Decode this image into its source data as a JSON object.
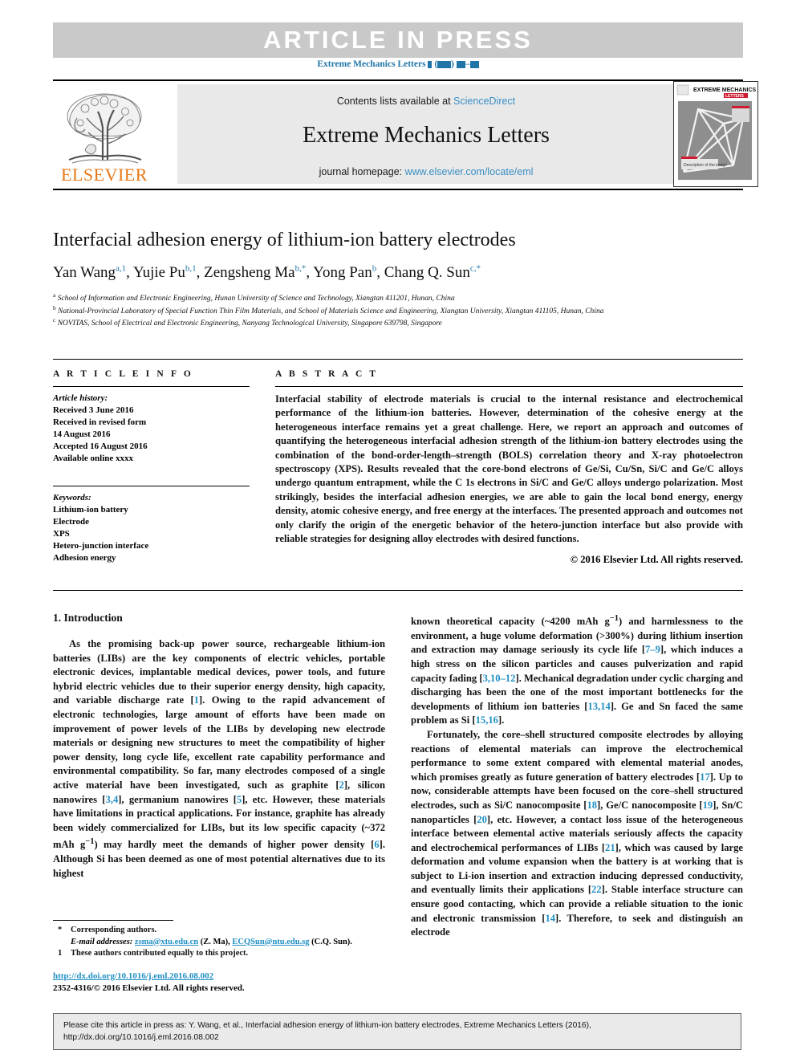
{
  "header": {
    "article_in_press": "ARTICLE  IN  PRESS",
    "running_journal": "Extreme Mechanics Letters",
    "running_suffix_open": "(",
    "running_suffix_close": ")",
    "running_dash": "–"
  },
  "masthead": {
    "contents_prefix": "Contents lists available at ",
    "contents_link": "ScienceDirect",
    "journal_title": "Extreme Mechanics Letters",
    "homepage_prefix": "journal homepage: ",
    "homepage_link": "www.elsevier.com/locate/eml",
    "publisher": "ELSEVIER",
    "cover_title_line1": "EXTREME MECHANICS",
    "cover_title_line2": "LETTERS",
    "cover_caption": "Description of the image",
    "accent_blue": "#1f74a8",
    "link_blue": "#3b8fc4",
    "elsevier_orange": "#e77817"
  },
  "article": {
    "title": "Interfacial adhesion energy of lithium-ion battery electrodes",
    "authors": [
      {
        "name": "Yan Wang",
        "sup": "a,1",
        "sep": ", "
      },
      {
        "name": "Yujie Pu",
        "sup": "b,1",
        "sep": ", "
      },
      {
        "name": "Zengsheng Ma",
        "sup": "b,*",
        "sep": ", "
      },
      {
        "name": "Yong Pan",
        "sup": "b",
        "sep": ", "
      },
      {
        "name": "Chang Q. Sun",
        "sup": "c,*",
        "sep": ""
      }
    ],
    "affiliations": [
      {
        "mark": "a",
        "text": "School of Information and Electronic Engineering, Hunan University of Science and Technology, Xiangtan 411201, Hunan, China"
      },
      {
        "mark": "b",
        "text": "National-Provincial Laboratory of Special Function Thin Film Materials, and School of Materials Science and Engineering, Xiangtan University, Xiangtan 411105, Hunan, China"
      },
      {
        "mark": "c",
        "text": "NOVITAS, School of Electrical and Electronic Engineering, Nanyang Technological University, Singapore 639798, Singapore"
      }
    ]
  },
  "info": {
    "heading": "A R T I C L E    I N F O",
    "history_label": "Article history:",
    "history": [
      "Received 3 June 2016",
      "Received in revised form",
      "14 August 2016",
      "Accepted 16 August 2016",
      "Available online xxxx"
    ],
    "keywords_label": "Keywords:",
    "keywords": [
      "Lithium-ion battery",
      "Electrode",
      "XPS",
      "Hetero-junction interface",
      "Adhesion energy"
    ]
  },
  "abstract": {
    "heading": "A B S T R A C T",
    "body": "Interfacial stability of electrode materials is crucial to the internal resistance and electrochemical performance of the lithium-ion batteries. However, determination of the cohesive energy at the heterogeneous interface remains yet a great challenge. Here, we report an approach and outcomes of quantifying the heterogeneous interfacial adhesion strength of the lithium-ion battery electrodes using the combination of the bond-order-length–strength (BOLS) correlation theory and X-ray photoelectron spectroscopy (XPS). Results revealed that the core-bond electrons of Ge/Si, Cu/Sn, Si/C and Ge/C alloys undergo quantum entrapment, while the C 1s electrons in Si/C and Ge/C alloys undergo polarization. Most strikingly, besides the interfacial adhesion energies, we are able to gain the local bond energy, energy density, atomic cohesive energy, and free energy at the interfaces. The presented approach and outcomes not only clarify the origin of the energetic behavior of the hetero-junction interface but also provide with reliable strategies for designing alloy electrodes with desired functions.",
    "copyright": "© 2016 Elsevier Ltd. All rights reserved."
  },
  "body": {
    "section_heading": "1. Introduction",
    "left_paragraph_html": "As the promising back-up power source, rechargeable lithium-ion batteries (LIBs) are the key components of electric vehicles, portable electronic devices, implantable medical devices, power tools, and future hybrid electric vehicles due to their superior energy density, high capacity, and variable discharge rate [<span class=\"ref\">1</span>]. Owing to the rapid advancement of electronic technologies, large amount of efforts have been made on improvement of power levels of the LIBs by developing new electrode materials or designing new structures to meet the compatibility of higher power density, long cycle life, excellent rate capability performance and environmental compatibility. So far, many electrodes composed of a single active material have been investigated, such as graphite [<span class=\"ref\">2</span>], silicon nanowires [<span class=\"ref\">3,4</span>], germanium nanowires [<span class=\"ref\">5</span>], etc. However, these materials have limitations in practical applications. For instance, graphite has already been widely commercialized for LIBs, but its low specific capacity (~372 mAh g<sup>−1</sup>) may hardly meet the demands of higher power density [<span class=\"ref\">6</span>]. Although Si has been deemed as one of most potential alternatives due to its highest",
    "right_paragraph1_html": "known theoretical capacity (~4200 mAh g<sup>−1</sup>) and harmlessness to the environment, a huge volume deformation (&gt;300%) during lithium insertion and extraction may damage seriously its cycle life [<span class=\"ref\">7–9</span>], which induces a high stress on the silicon particles and causes pulverization and rapid capacity fading [<span class=\"ref\">3,10–12</span>]. Mechanical degradation under cyclic charging and discharging has been the one of the most important bottlenecks for the developments of lithium ion batteries [<span class=\"ref\">13,14</span>]. Ge and Sn faced the same problem as Si [<span class=\"ref\">15,16</span>].",
    "right_paragraph2_html": "Fortunately, the core–shell structured composite electrodes by alloying reactions of elemental materials can improve the electrochemical performance to some extent compared with elemental material anodes, which promises greatly as future generation of battery electrodes [<span class=\"ref\">17</span>]. Up to now, considerable attempts have been focused on the core–shell structured electrodes, such as Si/C nanocomposite [<span class=\"ref\">18</span>], Ge/C nanocomposite [<span class=\"ref\">19</span>], Sn/C nanoparticles [<span class=\"ref\">20</span>], etc. However, a contact loss issue of the heterogeneous interface between elemental active materials seriously affects the capacity and electrochemical performances of LIBs [<span class=\"ref\">21</span>], which was caused by large deformation and volume expansion when the battery is at working that is subject to Li-ion insertion and extraction inducing depressed conductivity, and eventually limits their applications [<span class=\"ref\">22</span>]. Stable interface structure can ensure good contacting, which can provide a reliable situation to the ionic and electronic transmission [<span class=\"ref\">14</span>]. Therefore, to seek and distinguish an electrode"
  },
  "footnotes": {
    "corresponding_mark": "*",
    "corresponding_text": "Corresponding authors.",
    "email_label": "E-mail addresses:",
    "email1": "zsma@xtu.edu.cn",
    "email1_owner": "(Z. Ma),",
    "email2": "ECQSun@ntu.edu.sg",
    "email2_owner": "(C.Q. Sun).",
    "equal_mark": "1",
    "equal_text": "These authors contributed equally to this project.",
    "doi": "http://dx.doi.org/10.1016/j.eml.2016.08.002",
    "issn_line": "2352-4316/© 2016 Elsevier Ltd. All rights reserved."
  },
  "cite_box": {
    "line1": "Please cite this article in press as: Y. Wang, et al., Interfacial adhesion energy of lithium-ion battery electrodes, Extreme Mechanics Letters (2016),",
    "line2": "http://dx.doi.org/10.1016/j.eml.2016.08.002"
  }
}
